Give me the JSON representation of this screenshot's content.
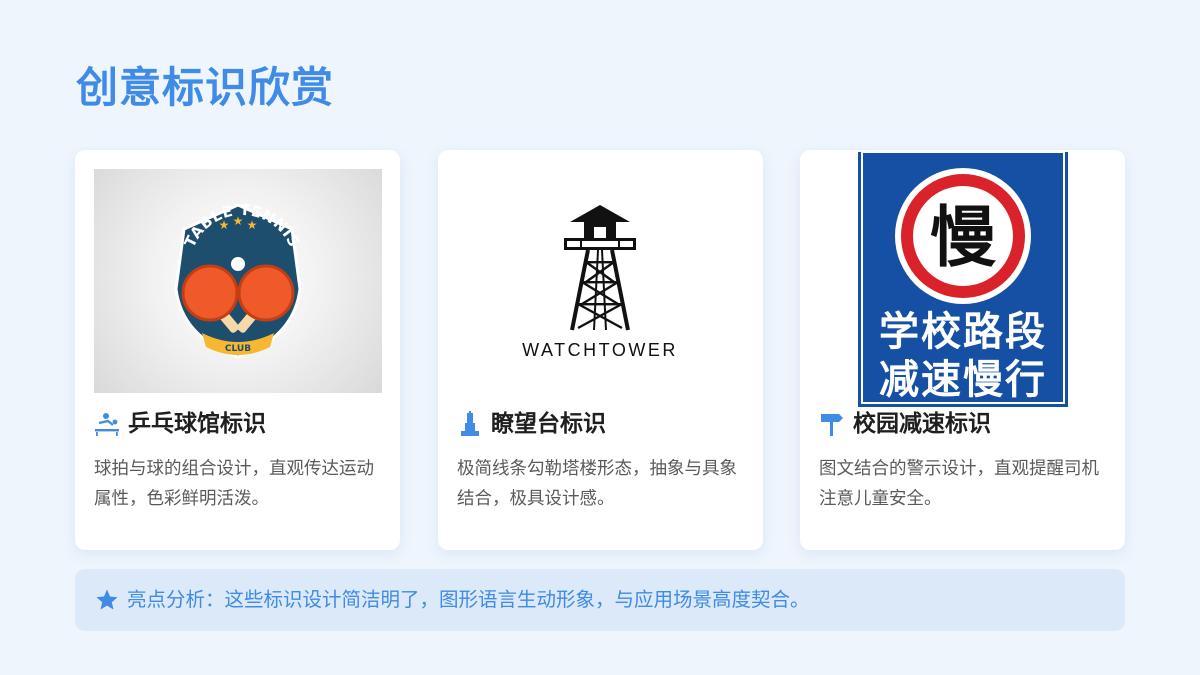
{
  "page": {
    "title": "创意标识欣赏",
    "accent_color": "#3f8be6",
    "background_color": "#eef5fd"
  },
  "cards": [
    {
      "title": "乒乓球馆标识",
      "icon": "table-tennis-player-icon",
      "description": "球拍与球的组合设计，直观传达运动属性，色彩鲜明活泼。",
      "logo": {
        "arc_text": "TABLE TENNIS",
        "ribbon_text": "CLUB",
        "colors": {
          "shield": "#1d4e6e",
          "paddle": "#f05a28",
          "ribbon": "#f7b731",
          "stars": "#f7b731"
        }
      }
    },
    {
      "title": "瞭望台标识",
      "icon": "watchtower-icon",
      "description": "极简线条勾勒塔楼形态，抽象与具象结合，极具设计感。",
      "logo": {
        "wordmark": "WATCHTOWER",
        "color": "#111111"
      }
    },
    {
      "title": "校园减速标识",
      "icon": "signpost-icon",
      "description": "图文结合的警示设计，直观提醒司机注意儿童安全。",
      "sign": {
        "circle_char": "慢",
        "line1": "学校路段",
        "line2": "减速慢行",
        "colors": {
          "panel": "#1550a4",
          "ring": "#d9222a"
        }
      }
    }
  ],
  "highlight": {
    "icon": "star-icon",
    "text": "亮点分析：这些标识设计简洁明了，图形语言生动形象，与应用场景高度契合。"
  }
}
